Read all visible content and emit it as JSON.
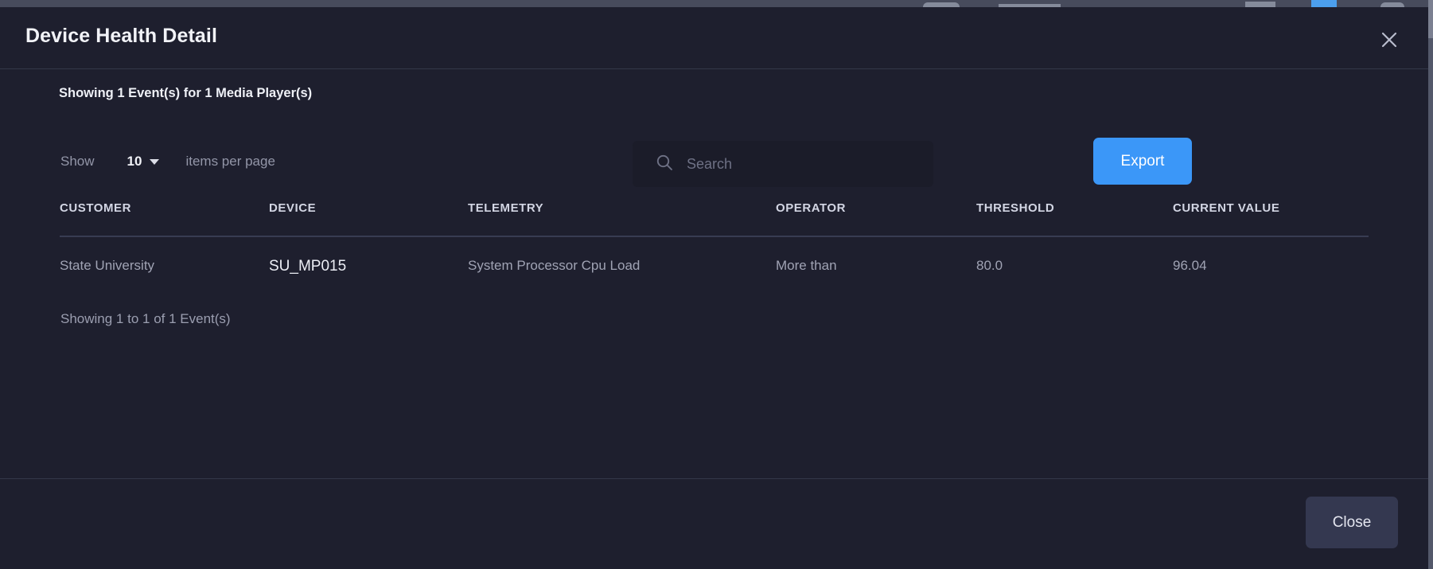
{
  "dialog": {
    "title": "Device Health Detail",
    "close_icon": "close-icon",
    "summary": "Showing 1 Event(s) for 1 Media Player(s)"
  },
  "controls": {
    "show_label": "Show",
    "page_size_value": "10",
    "page_size_caret_icon": "chevron-down-icon",
    "items_per_page_label": "items per page",
    "search": {
      "icon": "search-icon",
      "value": "",
      "placeholder": "Search"
    },
    "export_label": "Export"
  },
  "table": {
    "columns": [
      "CUSTOMER",
      "DEVICE",
      "TELEMETRY",
      "OPERATOR",
      "THRESHOLD",
      "CURRENT VALUE"
    ],
    "rows": [
      {
        "customer": "State University",
        "device": "SU_MP015",
        "telemetry": "System Processor Cpu Load",
        "operator": "More than",
        "threshold": "80.0",
        "current_value": "96.04"
      }
    ],
    "footer_status": "Showing 1 to 1 of 1 Event(s)"
  },
  "footer": {
    "close_label": "Close"
  },
  "colors": {
    "modal_background": "#1e1f2e",
    "accent_blue": "#3b97f8",
    "close_button": "#343850",
    "divider": "#343749",
    "text_primary": "#f2f3f8",
    "text_muted": "#9b9eb0"
  }
}
